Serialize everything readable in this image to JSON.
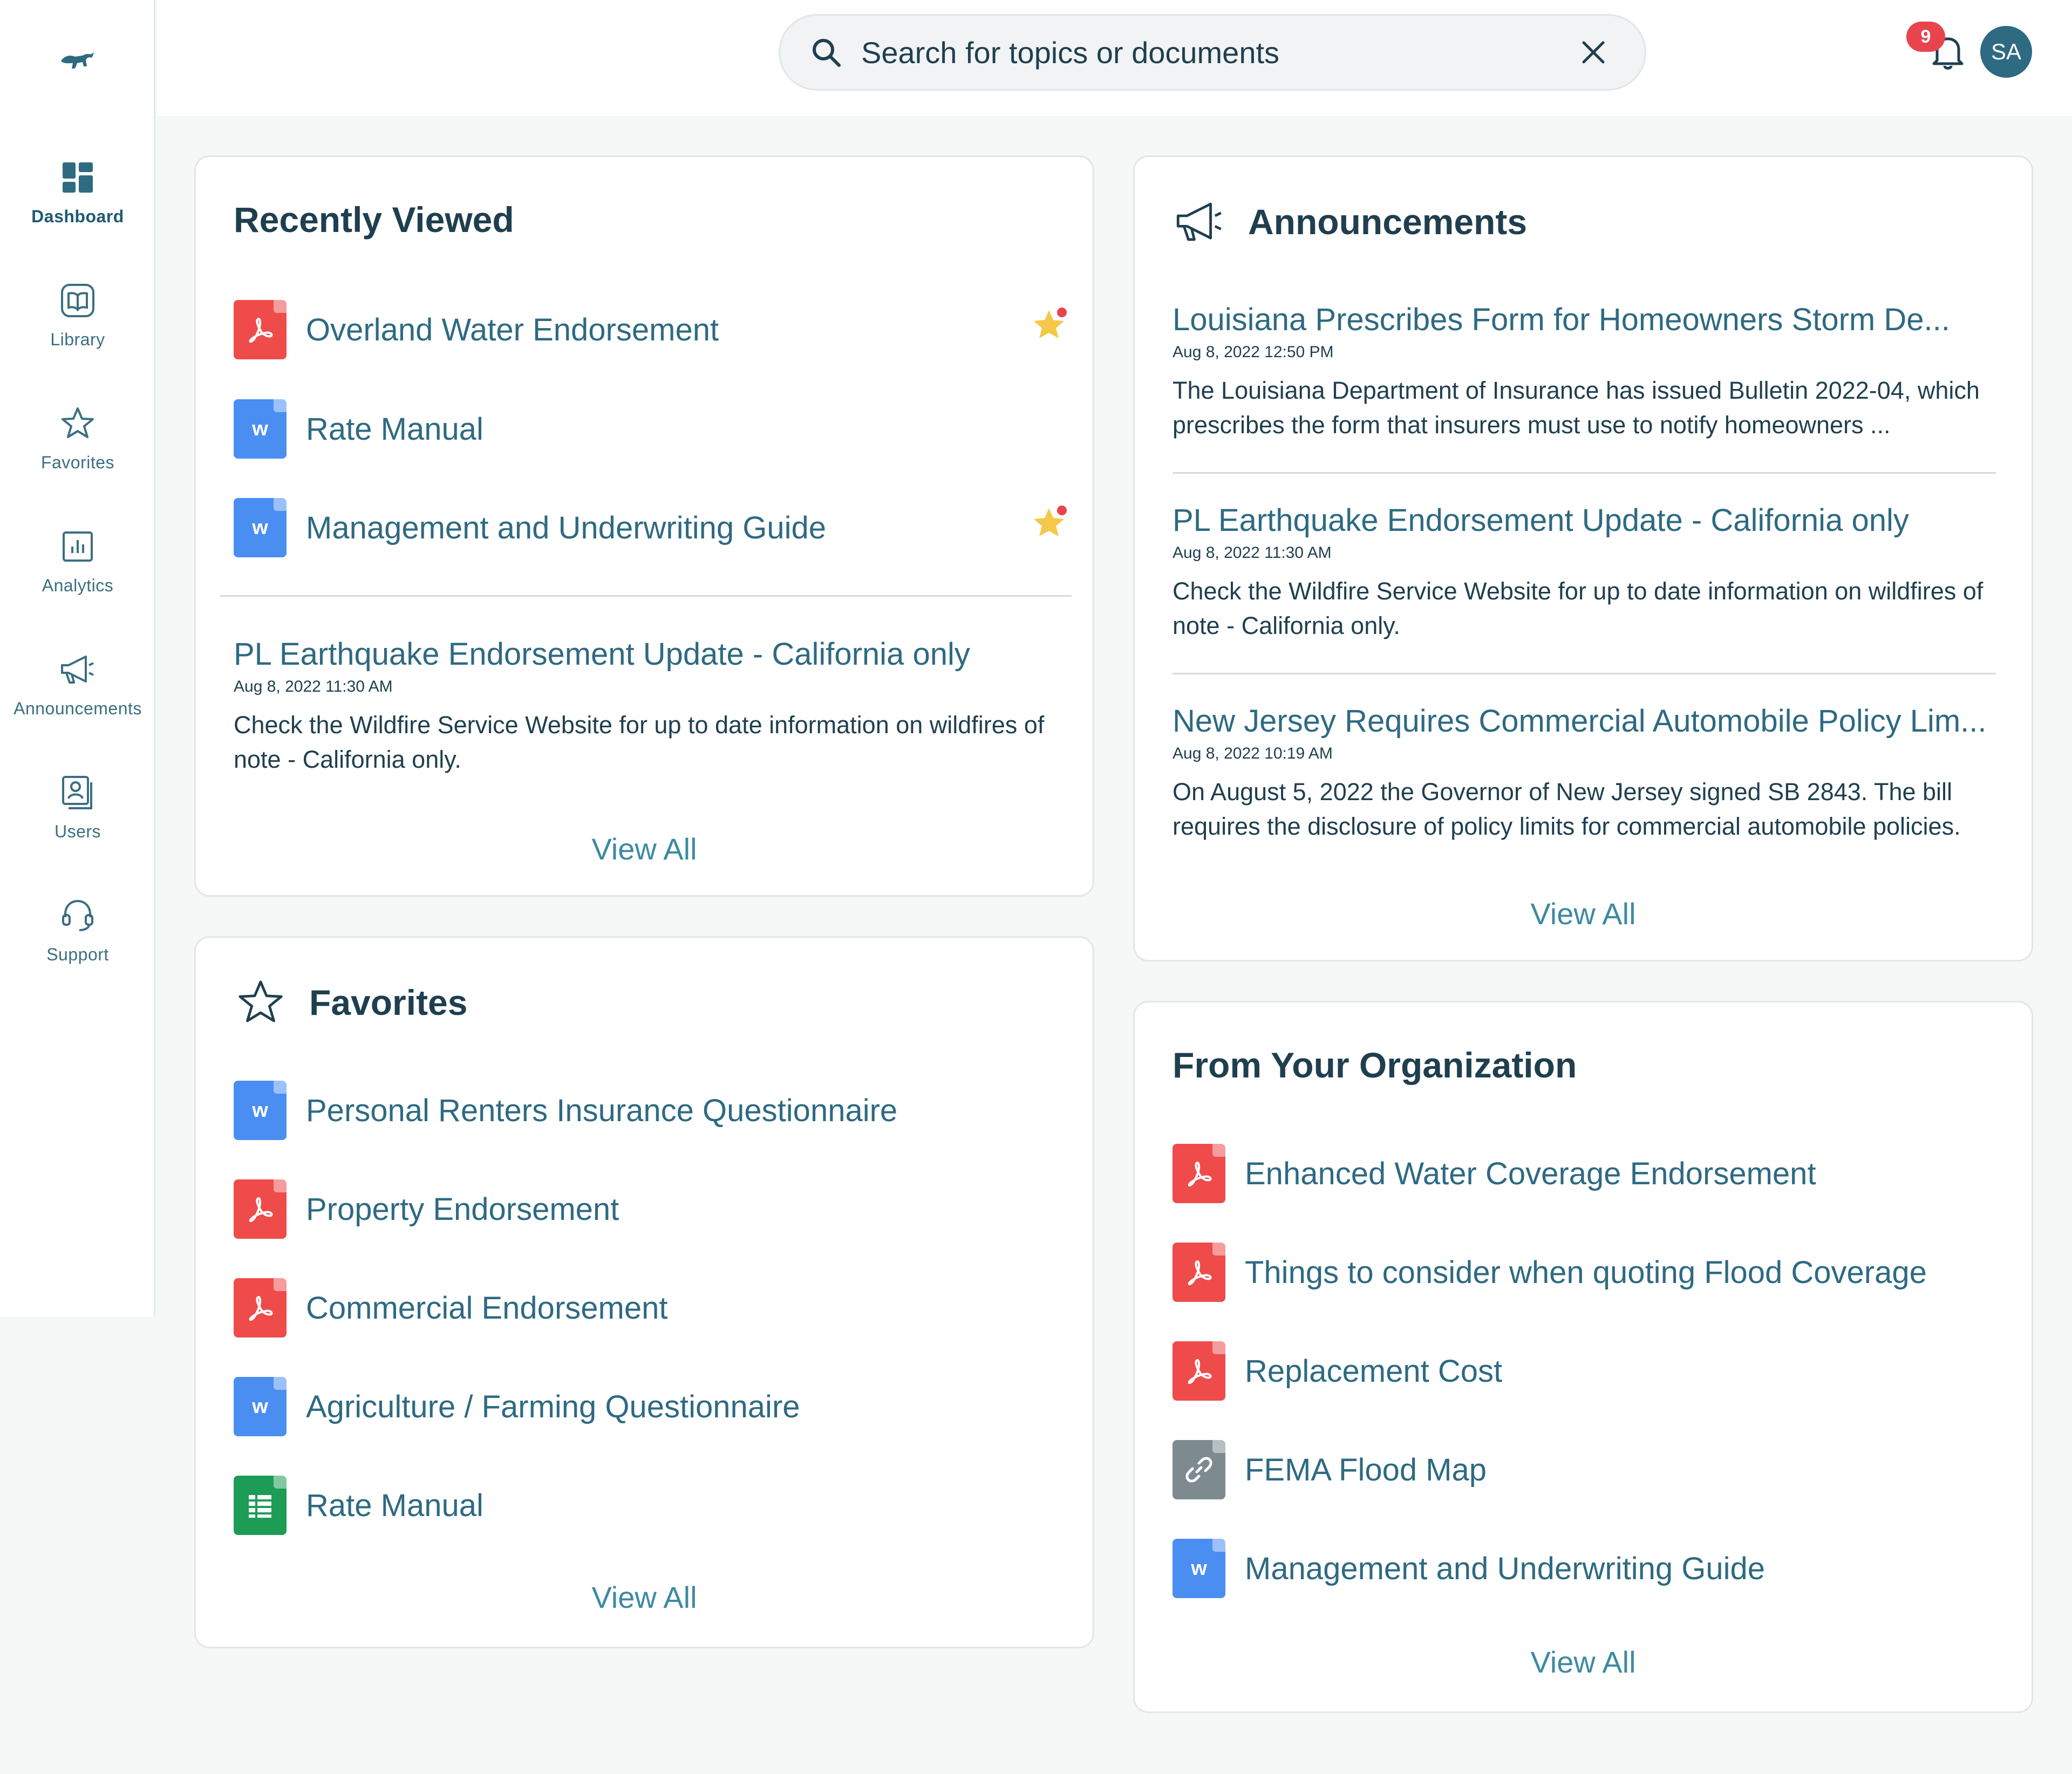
{
  "app": {
    "logo_icon": "bull-logo-icon"
  },
  "sidebar": {
    "items": [
      {
        "label": "Dashboard",
        "icon": "dashboard-icon",
        "active": true
      },
      {
        "label": "Library",
        "icon": "book-icon",
        "active": false
      },
      {
        "label": "Favorites",
        "icon": "star-icon",
        "active": false
      },
      {
        "label": "Analytics",
        "icon": "bar-chart-icon",
        "active": false
      },
      {
        "label": "Announcements",
        "icon": "megaphone-icon",
        "active": false
      },
      {
        "label": "Users",
        "icon": "user-card-icon",
        "active": false
      },
      {
        "label": "Support",
        "icon": "headset-icon",
        "active": false
      }
    ]
  },
  "header": {
    "search": {
      "placeholder": "Search for topics or documents",
      "value": ""
    },
    "notifications_count": "9",
    "avatar_initials": "SA"
  },
  "recently_viewed": {
    "title": "Recently Viewed",
    "docs": [
      {
        "name": "Overland Water Endorsement",
        "type": "pdf",
        "favorited": true
      },
      {
        "name": "Rate Manual",
        "type": "word",
        "favorited": false
      },
      {
        "name": "Management and Underwriting Guide",
        "type": "word",
        "favorited": true
      }
    ],
    "announcement": {
      "title": "PL Earthquake Endorsement Update - California only",
      "date": "Aug 8, 2022 11:30 AM",
      "body": "Check the Wildfire Service Website for up to date information on wildfires of note - California only."
    },
    "view_all": "View All"
  },
  "favorites": {
    "title": "Favorites",
    "docs": [
      {
        "name": "Personal Renters Insurance Questionnaire",
        "type": "word"
      },
      {
        "name": "Property Endorsement",
        "type": "pdf"
      },
      {
        "name": "Commercial Endorsement",
        "type": "pdf"
      },
      {
        "name": "Agriculture / Farming Questionnaire",
        "type": "word"
      },
      {
        "name": "Rate Manual",
        "type": "sheet"
      }
    ],
    "view_all": "View All"
  },
  "announcements": {
    "title": "Announcements",
    "items": [
      {
        "title": "Louisiana Prescribes Form for Homeowners Storm De...",
        "date": "Aug 8, 2022 12:50 PM",
        "body": "The Louisiana Department of Insurance has issued Bulletin 2022-04, which prescribes the form that insurers must use to notify homeowners ..."
      },
      {
        "title": "PL Earthquake Endorsement Update - California only",
        "date": "Aug 8, 2022 11:30 AM",
        "body": "Check the Wildfire Service Website for up to date information on wildfires of note - California only."
      },
      {
        "title": "New Jersey Requires Commercial Automobile Policy Lim...",
        "date": "Aug 8, 2022 10:19 AM",
        "body": "On August 5, 2022 the Governor of New Jersey signed SB 2843. The bill requires the disclosure of policy limits for commercial automobile policies."
      }
    ],
    "view_all": "View All"
  },
  "organization": {
    "title": "From Your Organization",
    "docs": [
      {
        "name": "Enhanced Water Coverage Endorsement",
        "type": "pdf"
      },
      {
        "name": "Things to consider when quoting Flood Coverage",
        "type": "pdf"
      },
      {
        "name": "Replacement Cost",
        "type": "pdf"
      },
      {
        "name": "FEMA Flood Map",
        "type": "link"
      },
      {
        "name": "Management and Underwriting Guide",
        "type": "word"
      }
    ],
    "view_all": "View All"
  },
  "colors": {
    "primary_text": "#1f3f4f",
    "link": "#2e6a82",
    "view_all": "#3d8aa2",
    "pdf": "#ef4b4b",
    "word": "#4a8ef2",
    "sheet": "#1d9c55",
    "link_file": "#7d8b91",
    "badge": "#e8444d",
    "star": "#f5c84a"
  }
}
